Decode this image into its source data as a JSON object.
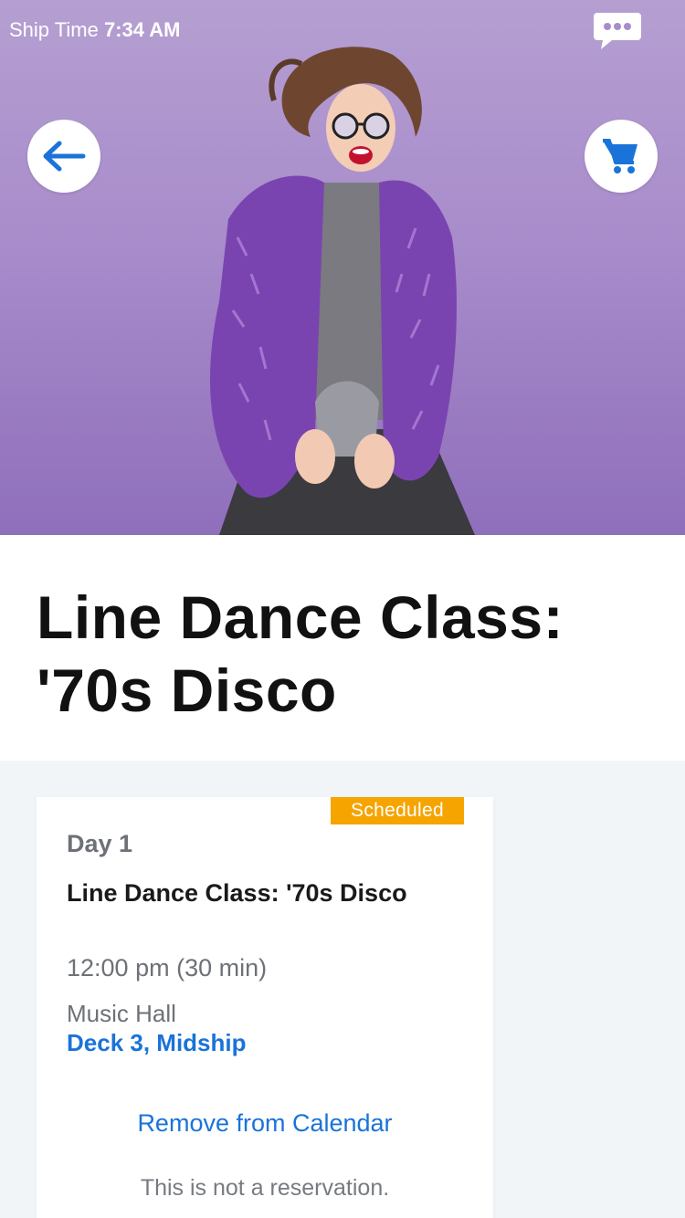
{
  "status_bar": {
    "prefix": "Ship Time",
    "time": "7:34 AM"
  },
  "header": {
    "chat_icon": "chat-bubble-icon",
    "back_icon": "arrow-left-icon",
    "cart_icon": "shopping-cart-icon"
  },
  "event": {
    "title": "Line Dance Class: '70s Disco"
  },
  "schedule_card": {
    "badge": "Scheduled",
    "day": "Day 1",
    "title": "Line Dance Class: '70s Disco",
    "time": "12:00 pm (30 min)",
    "venue": "Music Hall",
    "location": "Deck 3, Midship",
    "remove_label": "Remove from Calendar",
    "note": "This is not a reservation."
  },
  "colors": {
    "accent": "#1a73d9",
    "badge": "#f5a400",
    "hero_bg": "#a88ccb"
  }
}
